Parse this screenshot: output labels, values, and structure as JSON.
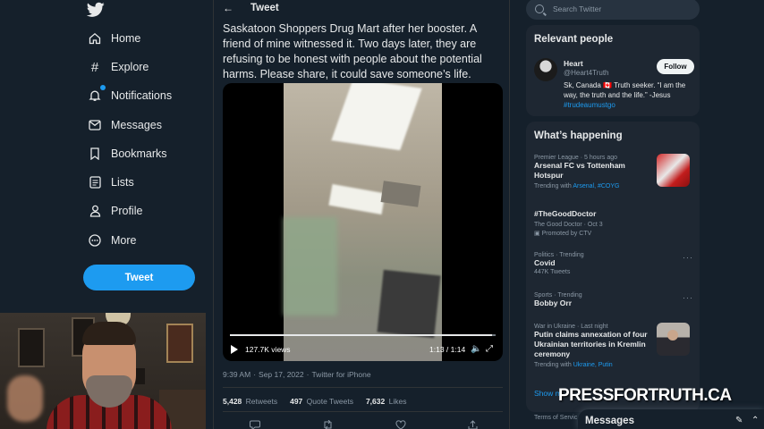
{
  "nav": {
    "items": [
      {
        "label": "Home",
        "icon": "home-icon"
      },
      {
        "label": "Explore",
        "icon": "hashtag-icon"
      },
      {
        "label": "Notifications",
        "icon": "bell-icon"
      },
      {
        "label": "Messages",
        "icon": "envelope-icon"
      },
      {
        "label": "Bookmarks",
        "icon": "bookmark-icon"
      },
      {
        "label": "Lists",
        "icon": "list-icon"
      },
      {
        "label": "Profile",
        "icon": "person-icon"
      },
      {
        "label": "More",
        "icon": "more-circle-icon"
      }
    ],
    "tweet_button": "Tweet"
  },
  "header": {
    "title": "Tweet",
    "back": "←"
  },
  "tweet": {
    "text": "Saskatoon Shoppers Drug Mart after her booster. A friend of mine witnessed it. Two days later, they are refusing to be honest with people about the potential harms. Please share, it could save someone’s life.",
    "video": {
      "views": "127.7K views",
      "time": "1:13 / 1:14",
      "progress": 0.987
    },
    "meta": {
      "time": "9:39 AM",
      "date": "Sep 17, 2022",
      "source": "Twitter for iPhone",
      "sep": "·"
    },
    "stats": {
      "retweets": "5,428",
      "retweets_label": "Retweets",
      "quotes": "497",
      "quotes_label": "Quote Tweets",
      "likes": "7,632",
      "likes_label": "Likes"
    }
  },
  "search": {
    "placeholder": "Search Twitter"
  },
  "relevant": {
    "title": "Relevant people",
    "name": "Heart",
    "handle": "@Heart4Truth",
    "follow": "Follow",
    "bio_text": "Sk, Canada 🇨🇦 Truth seeker. “I am the way, the truth and the life.” -Jesus",
    "bio_tag": "#trudeaumustgo"
  },
  "happening": {
    "title": "What’s happening",
    "trends": [
      {
        "ctx": "Premier League · 5 hours ago",
        "title": "Arsenal FC vs Tottenham Hotspur",
        "sub_prefix": "Trending with",
        "sub_links": "Arsenal, #COYG"
      },
      {
        "ctx": "",
        "title": "#TheGoodDoctor",
        "sub_line1": "The Good Doctor · Oct 3",
        "sub_line2": "Promoted by CTV"
      },
      {
        "ctx": "Politics · Trending",
        "title": "Covid",
        "sub": "447K Tweets"
      },
      {
        "ctx": "Sports · Trending",
        "title": "Bobby Orr"
      },
      {
        "ctx": "War in Ukraine · Last night",
        "title": "Putin claims annexation of four Ukrainian territories in Kremlin ceremony",
        "sub_prefix": "Trending with",
        "sub_links": "Ukraine, Putin"
      }
    ],
    "more_dots": "···",
    "show_more": "Show m",
    "terms": "Terms of Servic"
  },
  "watermark": "PRESSFORTRUTH.CA",
  "messages_drawer": {
    "label": "Messages",
    "new_icon": "✎",
    "collapse_icon": "⌃"
  }
}
